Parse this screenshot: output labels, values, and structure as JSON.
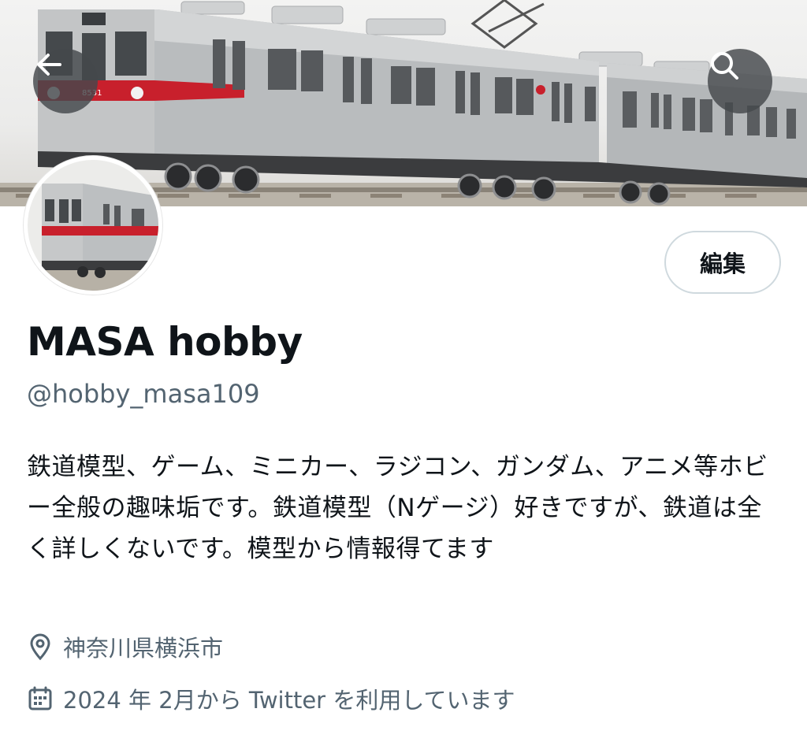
{
  "profile": {
    "display_name": "MASA hobby",
    "handle": "@hobby_masa109",
    "bio": "鉄道模型、ゲーム、ミニカー、ラジコン、ガンダム、アニメ等ホビー全般の趣味垢です。鉄道模型（Nゲージ）好きですが、鉄道は全く詳しくないです。模型から情報得てます",
    "location": "神奈川県横浜市",
    "joined": "2024 年 2月から Twitter を利用しています"
  },
  "header": {
    "back_icon": "arrow-left-icon",
    "search_icon": "search-icon",
    "edit_label": "編集"
  },
  "banner": {
    "train_number": "8531"
  },
  "colors": {
    "text_primary": "#0f1419",
    "text_secondary": "#536471",
    "button_border": "#cfd9de",
    "train_body": "#b9bcbe",
    "train_stripe": "#c8202c"
  }
}
